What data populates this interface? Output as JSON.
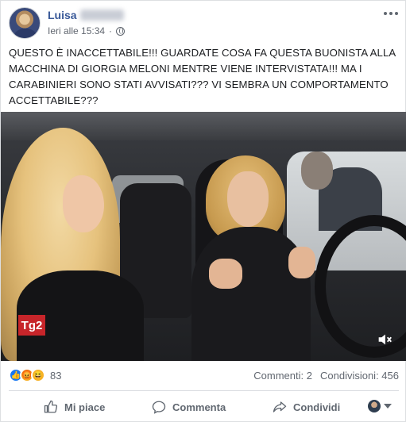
{
  "post": {
    "author": "Luisa",
    "timestamp": "Ieri alle 15:34",
    "privacy_icon": "globe-icon",
    "text": "QUESTO È INACCETTABILE!!! GUARDATE COSA FA QUESTA BUONISTA ALLA MACCHINA DI GIORGIA MELONI MENTRE VIENE INTERVISTATA!!! MA I CARABINIERI SONO STATI AVVISATI??? VI SEMBRA UN COMPORTAMENTO ACCETTABILE???"
  },
  "video": {
    "channel_logo": "Tg2",
    "muted_icon": "speaker-muted-icon"
  },
  "stats": {
    "reactions": [
      "like",
      "angry",
      "haha"
    ],
    "reaction_count": "83",
    "comments": "Commenti: 2",
    "shares": "Condivisioni: 456"
  },
  "actions": {
    "like_label": "Mi piace",
    "comment_label": "Commenta",
    "share_label": "Condividi"
  },
  "colors": {
    "author": "#385898",
    "like_blue": "#1877f2",
    "tg2_red": "#c7252a"
  }
}
